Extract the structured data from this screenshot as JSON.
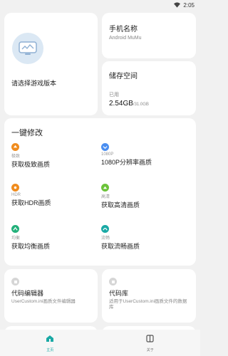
{
  "status_bar": {
    "time": "2:05",
    "wifi_icon": "wifi-icon"
  },
  "game": {
    "select_label": "请选择游戏版本"
  },
  "device": {
    "title": "手机名称",
    "name": "Android MuMu"
  },
  "storage": {
    "title": "储存空间",
    "used_label": "已用",
    "used_value": "2.54GB",
    "total_value": "/31.0GB"
  },
  "one_click": {
    "title": "一键修改",
    "options": [
      {
        "tag": "极致",
        "label": "获取极致画质",
        "color": "#f08c1e",
        "icon": "bolt-icon"
      },
      {
        "tag": "1080P",
        "label": "1080P分辨率画质",
        "color": "#4a8ef0",
        "icon": "hd-icon"
      },
      {
        "tag": "HDR",
        "label": "获取HDR画质",
        "color": "#f08c1e",
        "icon": "hdr-icon"
      },
      {
        "tag": "高清",
        "label": "获取高清画质",
        "color": "#6cc33a",
        "icon": "hq-icon"
      },
      {
        "tag": "均衡",
        "label": "获取均衡画质",
        "color": "#22b07a",
        "icon": "balance-icon"
      },
      {
        "tag": "流畅",
        "label": "获取流畅画质",
        "color": "#1aa9a5",
        "icon": "smooth-icon"
      }
    ]
  },
  "tools": [
    {
      "title": "代码编辑器",
      "desc": "UserCustom.ini画质文件编辑器",
      "icon": "code-icon"
    },
    {
      "title": "代码库",
      "desc": "适用于UserCustom.ini画质文件的数据库",
      "icon": "database-icon"
    }
  ],
  "nav": {
    "home_label": "主页",
    "about_label": "关于",
    "accent": "#1aa9a5"
  }
}
